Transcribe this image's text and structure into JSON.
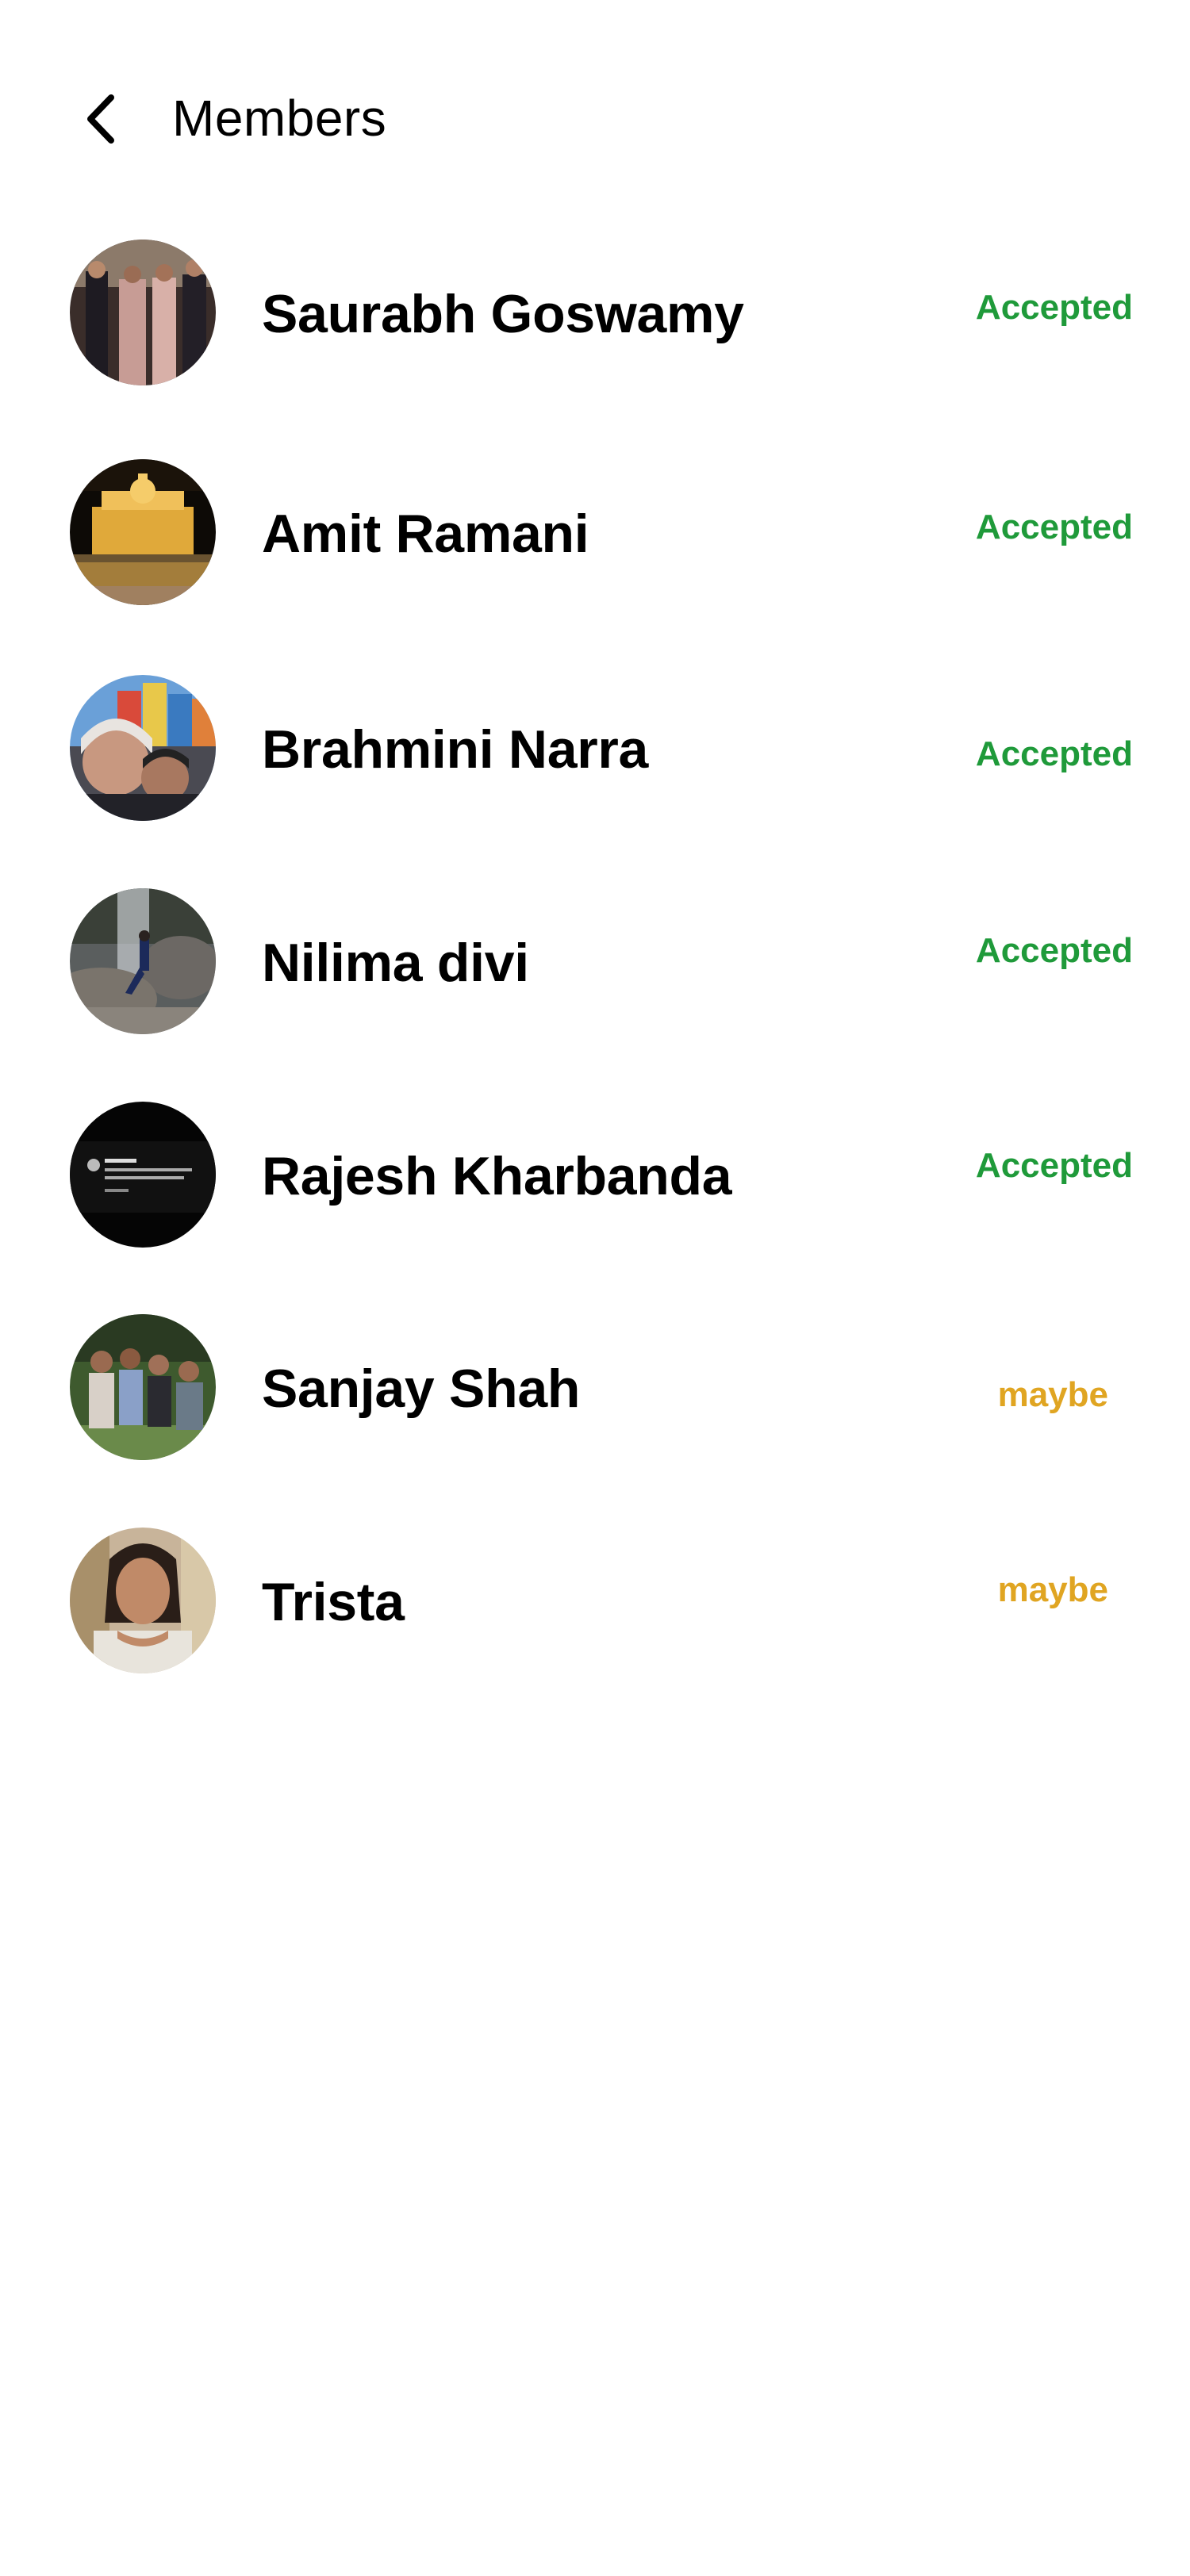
{
  "header": {
    "title": "Members"
  },
  "colors": {
    "accepted": "#1f9a3a",
    "maybe": "#e0a522",
    "text": "#000000",
    "background": "#ffffff"
  },
  "icons": {
    "back": "chevron-left-icon"
  },
  "members": [
    {
      "name": "Saurabh Goswamy",
      "status": "Accepted",
      "status_type": "accepted",
      "avatar": "group-photo-avatar"
    },
    {
      "name": "Amit Ramani",
      "status": "Accepted",
      "status_type": "accepted",
      "avatar": "golden-temple-avatar"
    },
    {
      "name": "Brahmini Narra",
      "status": "Accepted",
      "status_type": "accepted",
      "avatar": "selfie-avatar"
    },
    {
      "name": "Nilima divi",
      "status": "Accepted",
      "status_type": "accepted",
      "avatar": "rocks-waterfall-avatar"
    },
    {
      "name": "Rajesh Kharbanda",
      "status": "Accepted",
      "status_type": "accepted",
      "avatar": "quote-card-avatar"
    },
    {
      "name": "Sanjay Shah",
      "status": "maybe",
      "status_type": "maybe",
      "avatar": "family-group-avatar"
    },
    {
      "name": "Trista",
      "status": "maybe",
      "status_type": "maybe",
      "avatar": "portrait-avatar"
    }
  ]
}
